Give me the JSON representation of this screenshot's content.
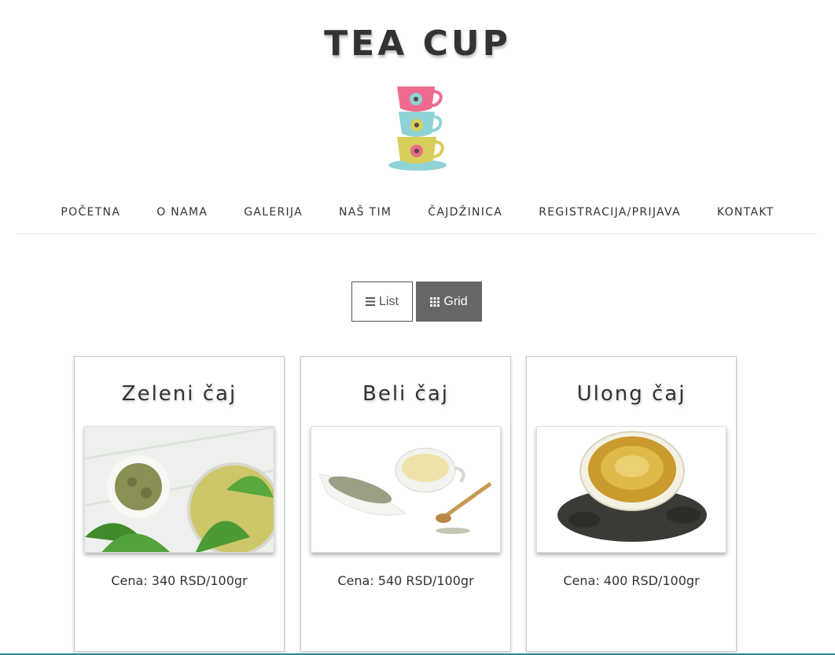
{
  "site": {
    "title": "TEA CUP"
  },
  "nav": {
    "items": [
      {
        "label": "POČETNA"
      },
      {
        "label": "O NAMA"
      },
      {
        "label": "GALERIJA"
      },
      {
        "label": "NAŠ TIM"
      },
      {
        "label": "ČAJDŽINICA"
      },
      {
        "label": "REGISTRACIJA/PRIJAVA"
      },
      {
        "label": "KONTAKT"
      }
    ]
  },
  "view_toggle": {
    "list_label": "List",
    "grid_label": "Grid",
    "active": "Grid",
    "list_icon": "list-icon",
    "grid_icon": "grid-icon"
  },
  "products": [
    {
      "name": "Zeleni čaj",
      "price": "Cena: 340 RSD/100gr"
    },
    {
      "name": "Beli čaj",
      "price": "Cena: 540 RSD/100gr"
    },
    {
      "name": "Ulong čaj",
      "price": "Cena: 400 RSD/100gr"
    }
  ],
  "colors": {
    "text": "#333333",
    "active_button": "#666666",
    "accent_rule": "#2a8c8c"
  }
}
